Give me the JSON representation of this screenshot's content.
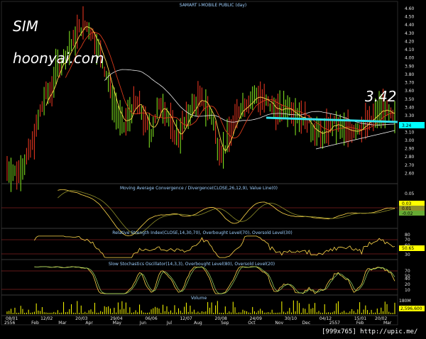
{
  "chart_data": {
    "type": "stock-chart",
    "title": "SAMART I-MOBILE PUBLIC (day)",
    "annotations": {
      "ticker": "SIM",
      "source": "hoonyai.com",
      "last_price_callout": "3.42",
      "credit": "[999x765] http://upic.me/"
    },
    "colors": {
      "up_bar": "#7ddc1f",
      "down_bar": "#e0341f",
      "ma_fast": "#ffd84a",
      "ma_mid": "#d83a1a",
      "ma_slow": "#e8e8e8",
      "support_line": "#34e4ee",
      "marker_yellow": "#ffff00",
      "marker_cyan": "#00ffff"
    },
    "price": {
      "ylim": [
        2.5,
        4.6
      ],
      "yticks": [
        "4.60",
        "4.50",
        "4.40",
        "4.30",
        "4.20",
        "4.10",
        "4.00",
        "3.90",
        "3.80",
        "3.70",
        "3.60",
        "3.50",
        "3.40",
        "3.30",
        "3.20",
        "3.10",
        "3.00",
        "2.90",
        "2.80",
        "2.70",
        "2.60"
      ],
      "last_marker": "3.24",
      "support_level": 3.25,
      "series_close": [
        2.66,
        2.62,
        2.6,
        2.72,
        2.85,
        3.05,
        3.35,
        3.55,
        3.6,
        3.9,
        3.95,
        4.1,
        4.2,
        4.35,
        4.4,
        4.35,
        4.2,
        4.0,
        3.8,
        3.5,
        3.3,
        3.15,
        3.3,
        3.45,
        3.4,
        3.2,
        3.1,
        3.35,
        3.45,
        3.3,
        3.1,
        3.05,
        3.2,
        3.35,
        3.45,
        3.5,
        3.4,
        3.3,
        2.95,
        2.85,
        3.05,
        3.2,
        3.4,
        3.45,
        3.5,
        3.55,
        3.5,
        3.45,
        3.4,
        3.35,
        3.38,
        3.4,
        3.35,
        3.3,
        3.25,
        3.15,
        3.1,
        3.05,
        3.15,
        3.2,
        3.15,
        3.1,
        3.12,
        3.15,
        3.18,
        3.2,
        3.25,
        3.35,
        3.38,
        3.3,
        3.24
      ]
    },
    "macd": {
      "title": "Moving Average Convergence / Divergence(CLOSE,26,12,9), Value Line(0)",
      "yticks": [
        "0.05",
        "0.03",
        "0.01",
        "-0.02"
      ],
      "markers": [
        "0.03",
        "0.01",
        "-0.02"
      ],
      "ylim": [
        -0.04,
        0.07
      ]
    },
    "rsi": {
      "title": "Relative Strength Index(CLOSE,14,30,70), Overbought Level(70), Oversold Level(30)",
      "yticks": [
        "80",
        "70",
        "60",
        "30"
      ],
      "last_marker": "50.65",
      "ylim": [
        20,
        90
      ]
    },
    "stoch": {
      "title": "Slow Stochastics Oscillator(14,3,3), Overbought Level(80), Oversold Level(20)",
      "yticks": [
        "70",
        "50",
        "40",
        "20",
        "10"
      ],
      "ylim": [
        0,
        100
      ]
    },
    "volume": {
      "title": "Volume",
      "yticks": [
        "180M"
      ],
      "last_marker": "2,596,600"
    },
    "x_dates_top": [
      "08/01",
      "12/02",
      "20/03",
      "29/04",
      "06/06",
      "12/07",
      "20/08",
      "24/09",
      "30/10",
      "04/12",
      "15/01",
      "20/02"
    ],
    "x_months_bottom": [
      "2556",
      "Feb",
      "Mar",
      "Apr",
      "May",
      "Jun",
      "Jul",
      "Aug",
      "Sep",
      "Oct",
      "Nov",
      "Dec",
      "2557",
      "Feb",
      "Mar"
    ]
  }
}
